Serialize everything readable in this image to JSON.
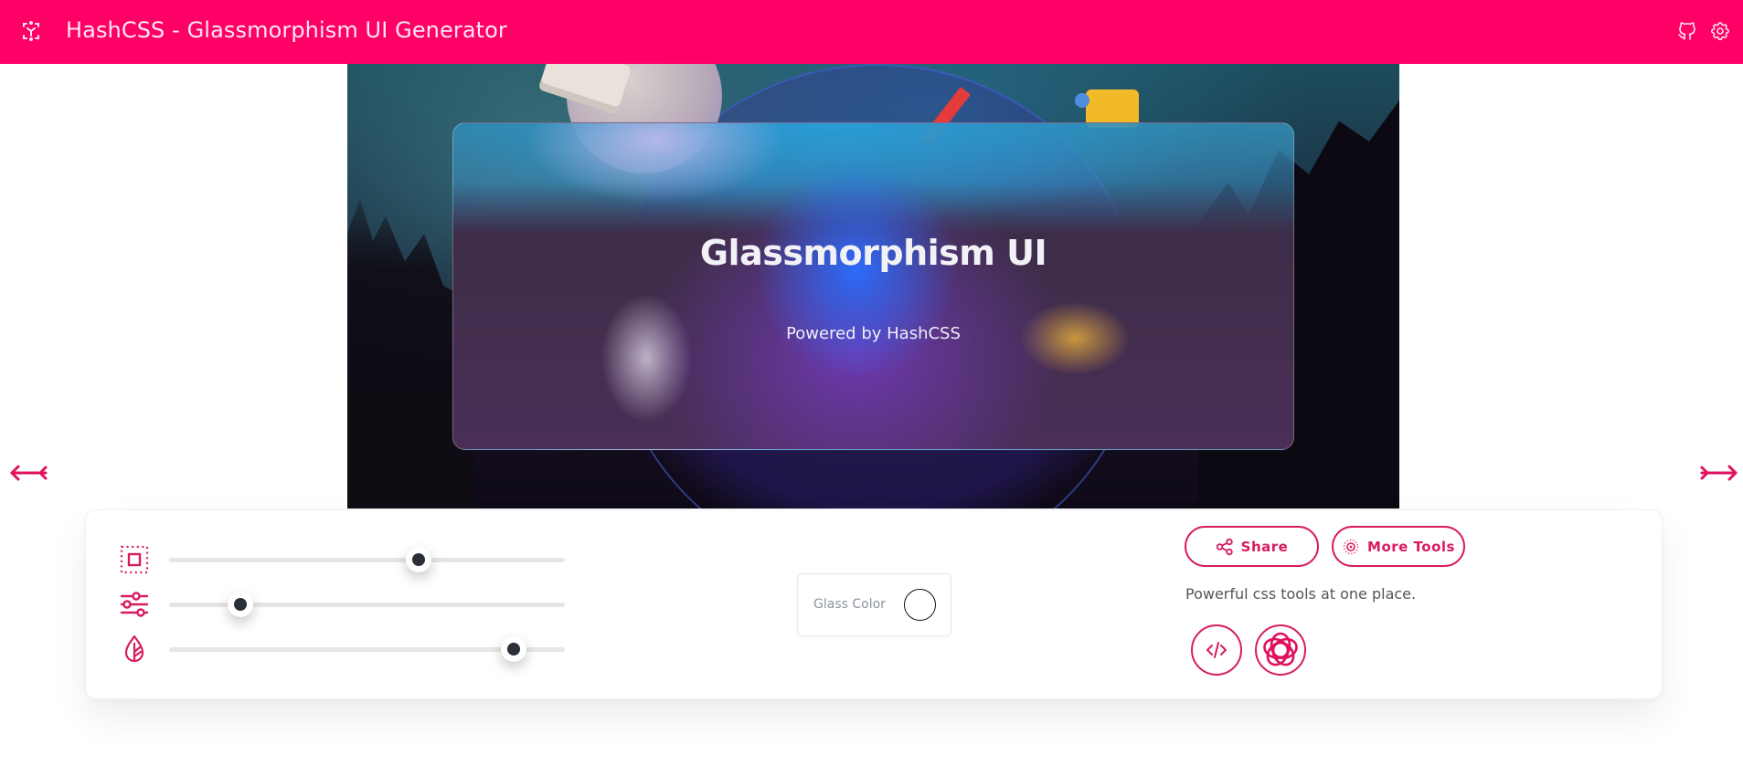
{
  "header": {
    "title": "HashCSS - Glassmorphism UI Generator",
    "logo_icon": "hashcss-logo-icon",
    "actions": [
      {
        "name": "github",
        "icon": "github-icon"
      },
      {
        "name": "settings",
        "icon": "gear-icon"
      }
    ],
    "background_color": "#ff0066"
  },
  "preview": {
    "card_title": "Glassmorphism UI",
    "card_subtitle": "Powered by HashCSS"
  },
  "navigation": {
    "prev_icon": "arrow-left-icon",
    "next_icon": "arrow-right-icon"
  },
  "controls": {
    "sliders": [
      {
        "name": "size",
        "icon": "selection-square-icon",
        "value_percent": 63
      },
      {
        "name": "transparency",
        "icon": "sliders-icon",
        "value_percent": 18
      },
      {
        "name": "blur",
        "icon": "leaf-drop-icon",
        "value_percent": 87
      }
    ],
    "glass_color": {
      "label": "Glass Color",
      "value": "#ffffff"
    },
    "share_label": "Share",
    "more_tools_label": "More Tools",
    "tagline": "Powerful css tools at one place.",
    "icon_buttons": [
      {
        "name": "code",
        "icon": "code-icon"
      },
      {
        "name": "swirl",
        "icon": "swirl-logo-icon"
      }
    ],
    "accent_color": "#d81b60"
  }
}
